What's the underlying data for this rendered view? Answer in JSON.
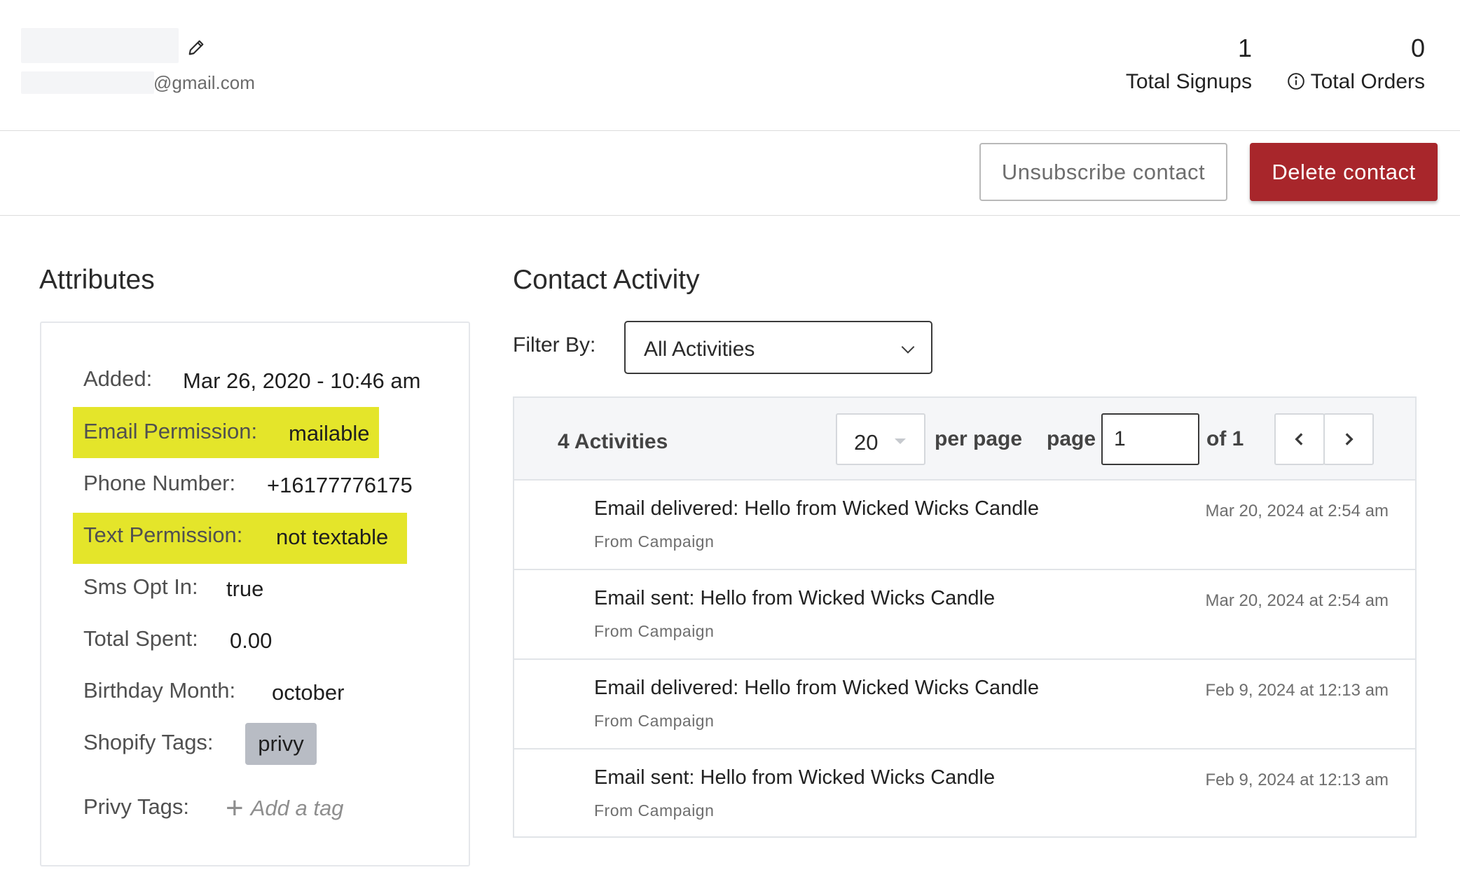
{
  "contact": {
    "email_suffix": "@gmail.com"
  },
  "stats": {
    "signups_value": "1",
    "signups_label": "Total Signups",
    "orders_value": "0",
    "orders_label": "Total Orders"
  },
  "actions": {
    "unsubscribe_label": "Unsubscribe contact",
    "delete_label": "Delete contact"
  },
  "attributes": {
    "title": "Attributes",
    "added_label": "Added:",
    "added_value": "Mar 26, 2020 - 10:46 am",
    "email_perm_label": "Email Permission:",
    "email_perm_value": "mailable",
    "phone_label": "Phone Number:",
    "phone_value": "+16177776175",
    "text_perm_label": "Text Permission:",
    "text_perm_value": "not textable",
    "sms_label": "Sms Opt In:",
    "sms_value": "true",
    "spent_label": "Total Spent:",
    "spent_value": "0.00",
    "birthday_label": "Birthday Month:",
    "birthday_value": "october",
    "shopify_label": "Shopify Tags:",
    "shopify_tag": "privy",
    "privy_label": "Privy Tags:",
    "add_tag": "Add a tag"
  },
  "activity": {
    "title": "Contact Activity",
    "filter_label": "Filter By:",
    "filter_value": "All Activities",
    "count": "4 Activities",
    "per_page_value": "20",
    "per_page_label": "per page",
    "page_label": "page",
    "page_value": "1",
    "of_label": "of 1",
    "items": [
      {
        "title": "Email delivered: Hello from Wicked Wicks Candle",
        "source": "From Campaign",
        "date": "Mar 20, 2024 at 2:54 am"
      },
      {
        "title": "Email sent: Hello from Wicked Wicks Candle",
        "source": "From Campaign",
        "date": "Mar 20, 2024 at 2:54 am"
      },
      {
        "title": "Email delivered: Hello from Wicked Wicks Candle",
        "source": "From Campaign",
        "date": "Feb 9, 2024 at 12:13 am"
      },
      {
        "title": "Email sent: Hello from Wicked Wicks Candle",
        "source": "From Campaign",
        "date": "Feb 9, 2024 at 12:13 am"
      }
    ]
  },
  "colors": {
    "delete_button": "#a8262b",
    "highlight": "#e4e52a",
    "tag_chip": "#b8bcc4"
  }
}
